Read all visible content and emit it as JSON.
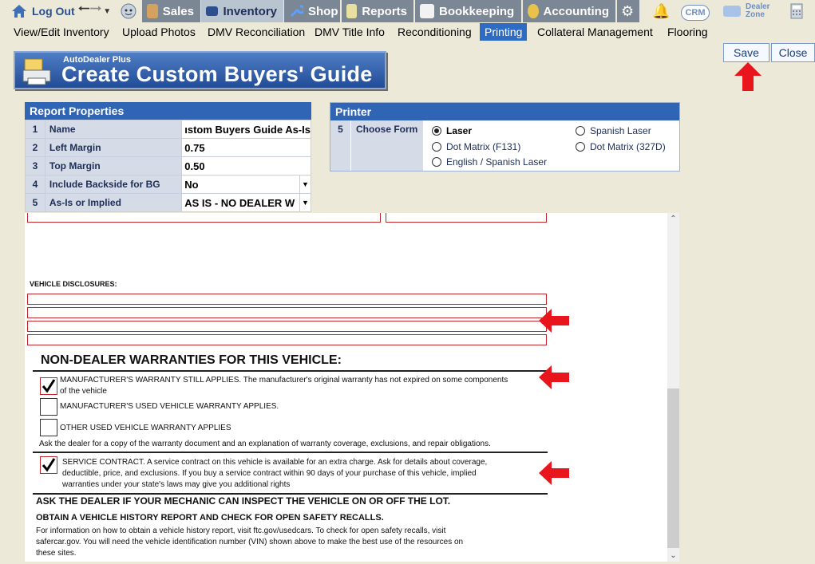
{
  "topnav": {
    "logout": "Log Out",
    "sales": "Sales",
    "inventory": "Inventory",
    "shop": "Shop",
    "reports": "Reports",
    "bookkeeping": "Bookkeeping",
    "accounting": "Accounting",
    "crm": "CRM",
    "dealer_zone_1": "Dealer",
    "dealer_zone_2": "Zone"
  },
  "subnav": [
    "View/Edit Inventory",
    "Upload Photos",
    "DMV Reconciliation",
    "DMV Title Info",
    "Reconditioning",
    "Printing",
    "Collateral Management",
    "Flooring"
  ],
  "banner": {
    "subtitle": "AutoDealer Plus",
    "title": "Create Custom Buyers' Guide"
  },
  "buttons": {
    "save": "Save",
    "close": "Close"
  },
  "report_properties": {
    "title": "Report Properties",
    "rows": [
      {
        "num": "1",
        "label": "Name",
        "value": "ıstom Buyers Guide As-Is"
      },
      {
        "num": "2",
        "label": "Left Margin",
        "value": "0.75"
      },
      {
        "num": "3",
        "label": "Top Margin",
        "value": "0.50"
      },
      {
        "num": "4",
        "label": "Include Backside for BG",
        "value": "No"
      },
      {
        "num": "5",
        "label": "As-Is or Implied",
        "value": "AS IS - NO DEALER W"
      }
    ]
  },
  "printer": {
    "title": "Printer",
    "num": "5",
    "label": "Choose Form",
    "options": {
      "laser": "Laser",
      "spanish_laser": "Spanish Laser",
      "dot_matrix_f131": "Dot Matrix (F131)",
      "dot_matrix_327d": "Dot Matrix (327D)",
      "english_spanish_laser": "English / Spanish Laser"
    },
    "selected": "Laser"
  },
  "document": {
    "vehicle_disclosures": "VEHICLE DISCLOSURES:",
    "non_dealer_heading": "NON-DEALER WARRANTIES FOR THIS VEHICLE:",
    "mfr_still_applies_1": "MANUFACTURER'S WARRANTY STILL APPLIES. The manufacturer's original warranty has not expired on some components",
    "mfr_still_applies_2": "of the vehicle",
    "mfr_used_applies": "MANUFACTURER'S USED VEHICLE WARRANTY APPLIES.",
    "other_used_applies": "OTHER USED VEHICLE WARRANTY APPLIES",
    "ask_dealer_copy": "Ask the dealer for a copy of the warranty document and an explanation of warranty coverage, exclusions, and repair obligations.",
    "service_contract_1": "SERVICE CONTRACT. A service contract on this vehicle is available for an extra charge. Ask for details about coverage,",
    "service_contract_2": "deductible, price, and exclusions. If you buy a service contract within 90 days of your purchase of this vehicle, implied",
    "service_contract_3": "warranties under your state's laws may give you additional rights",
    "ask_mechanic": "ASK THE DEALER IF YOUR MECHANIC CAN INSPECT THE VEHICLE ON OR OFF THE LOT.",
    "obtain_history": "OBTAIN A VEHICLE HISTORY REPORT AND CHECK FOR OPEN SAFETY RECALLS.",
    "history_info_1": "For information on how to obtain a vehicle history report, visit ftc.gov/usedcars. To check for open safety recalls, visit",
    "history_info_2": "safercar.gov.  You will need the vehicle identification number (VIN) shown above to make the best use of the resources on",
    "history_info_3": "these sites."
  }
}
